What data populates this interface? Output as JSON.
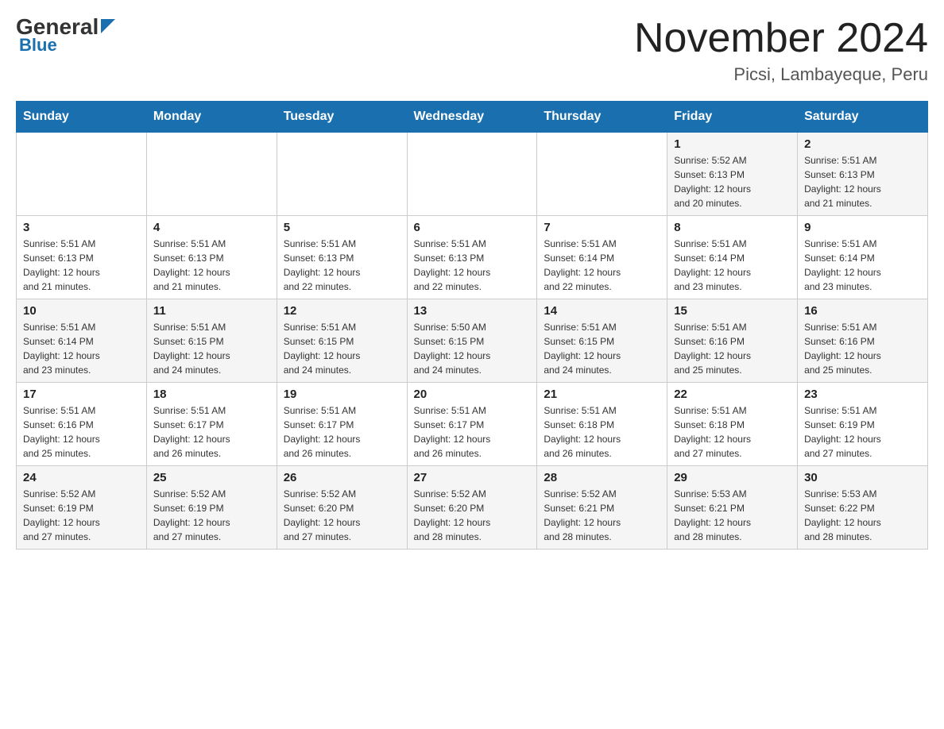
{
  "header": {
    "logo": {
      "general": "General",
      "blue": "Blue"
    },
    "title": "November 2024",
    "location": "Picsi, Lambayeque, Peru"
  },
  "days_of_week": [
    "Sunday",
    "Monday",
    "Tuesday",
    "Wednesday",
    "Thursday",
    "Friday",
    "Saturday"
  ],
  "weeks": [
    [
      {
        "day": "",
        "info": ""
      },
      {
        "day": "",
        "info": ""
      },
      {
        "day": "",
        "info": ""
      },
      {
        "day": "",
        "info": ""
      },
      {
        "day": "",
        "info": ""
      },
      {
        "day": "1",
        "info": "Sunrise: 5:52 AM\nSunset: 6:13 PM\nDaylight: 12 hours\nand 20 minutes."
      },
      {
        "day": "2",
        "info": "Sunrise: 5:51 AM\nSunset: 6:13 PM\nDaylight: 12 hours\nand 21 minutes."
      }
    ],
    [
      {
        "day": "3",
        "info": "Sunrise: 5:51 AM\nSunset: 6:13 PM\nDaylight: 12 hours\nand 21 minutes."
      },
      {
        "day": "4",
        "info": "Sunrise: 5:51 AM\nSunset: 6:13 PM\nDaylight: 12 hours\nand 21 minutes."
      },
      {
        "day": "5",
        "info": "Sunrise: 5:51 AM\nSunset: 6:13 PM\nDaylight: 12 hours\nand 22 minutes."
      },
      {
        "day": "6",
        "info": "Sunrise: 5:51 AM\nSunset: 6:13 PM\nDaylight: 12 hours\nand 22 minutes."
      },
      {
        "day": "7",
        "info": "Sunrise: 5:51 AM\nSunset: 6:14 PM\nDaylight: 12 hours\nand 22 minutes."
      },
      {
        "day": "8",
        "info": "Sunrise: 5:51 AM\nSunset: 6:14 PM\nDaylight: 12 hours\nand 23 minutes."
      },
      {
        "day": "9",
        "info": "Sunrise: 5:51 AM\nSunset: 6:14 PM\nDaylight: 12 hours\nand 23 minutes."
      }
    ],
    [
      {
        "day": "10",
        "info": "Sunrise: 5:51 AM\nSunset: 6:14 PM\nDaylight: 12 hours\nand 23 minutes."
      },
      {
        "day": "11",
        "info": "Sunrise: 5:51 AM\nSunset: 6:15 PM\nDaylight: 12 hours\nand 24 minutes."
      },
      {
        "day": "12",
        "info": "Sunrise: 5:51 AM\nSunset: 6:15 PM\nDaylight: 12 hours\nand 24 minutes."
      },
      {
        "day": "13",
        "info": "Sunrise: 5:50 AM\nSunset: 6:15 PM\nDaylight: 12 hours\nand 24 minutes."
      },
      {
        "day": "14",
        "info": "Sunrise: 5:51 AM\nSunset: 6:15 PM\nDaylight: 12 hours\nand 24 minutes."
      },
      {
        "day": "15",
        "info": "Sunrise: 5:51 AM\nSunset: 6:16 PM\nDaylight: 12 hours\nand 25 minutes."
      },
      {
        "day": "16",
        "info": "Sunrise: 5:51 AM\nSunset: 6:16 PM\nDaylight: 12 hours\nand 25 minutes."
      }
    ],
    [
      {
        "day": "17",
        "info": "Sunrise: 5:51 AM\nSunset: 6:16 PM\nDaylight: 12 hours\nand 25 minutes."
      },
      {
        "day": "18",
        "info": "Sunrise: 5:51 AM\nSunset: 6:17 PM\nDaylight: 12 hours\nand 26 minutes."
      },
      {
        "day": "19",
        "info": "Sunrise: 5:51 AM\nSunset: 6:17 PM\nDaylight: 12 hours\nand 26 minutes."
      },
      {
        "day": "20",
        "info": "Sunrise: 5:51 AM\nSunset: 6:17 PM\nDaylight: 12 hours\nand 26 minutes."
      },
      {
        "day": "21",
        "info": "Sunrise: 5:51 AM\nSunset: 6:18 PM\nDaylight: 12 hours\nand 26 minutes."
      },
      {
        "day": "22",
        "info": "Sunrise: 5:51 AM\nSunset: 6:18 PM\nDaylight: 12 hours\nand 27 minutes."
      },
      {
        "day": "23",
        "info": "Sunrise: 5:51 AM\nSunset: 6:19 PM\nDaylight: 12 hours\nand 27 minutes."
      }
    ],
    [
      {
        "day": "24",
        "info": "Sunrise: 5:52 AM\nSunset: 6:19 PM\nDaylight: 12 hours\nand 27 minutes."
      },
      {
        "day": "25",
        "info": "Sunrise: 5:52 AM\nSunset: 6:19 PM\nDaylight: 12 hours\nand 27 minutes."
      },
      {
        "day": "26",
        "info": "Sunrise: 5:52 AM\nSunset: 6:20 PM\nDaylight: 12 hours\nand 27 minutes."
      },
      {
        "day": "27",
        "info": "Sunrise: 5:52 AM\nSunset: 6:20 PM\nDaylight: 12 hours\nand 28 minutes."
      },
      {
        "day": "28",
        "info": "Sunrise: 5:52 AM\nSunset: 6:21 PM\nDaylight: 12 hours\nand 28 minutes."
      },
      {
        "day": "29",
        "info": "Sunrise: 5:53 AM\nSunset: 6:21 PM\nDaylight: 12 hours\nand 28 minutes."
      },
      {
        "day": "30",
        "info": "Sunrise: 5:53 AM\nSunset: 6:22 PM\nDaylight: 12 hours\nand 28 minutes."
      }
    ]
  ]
}
